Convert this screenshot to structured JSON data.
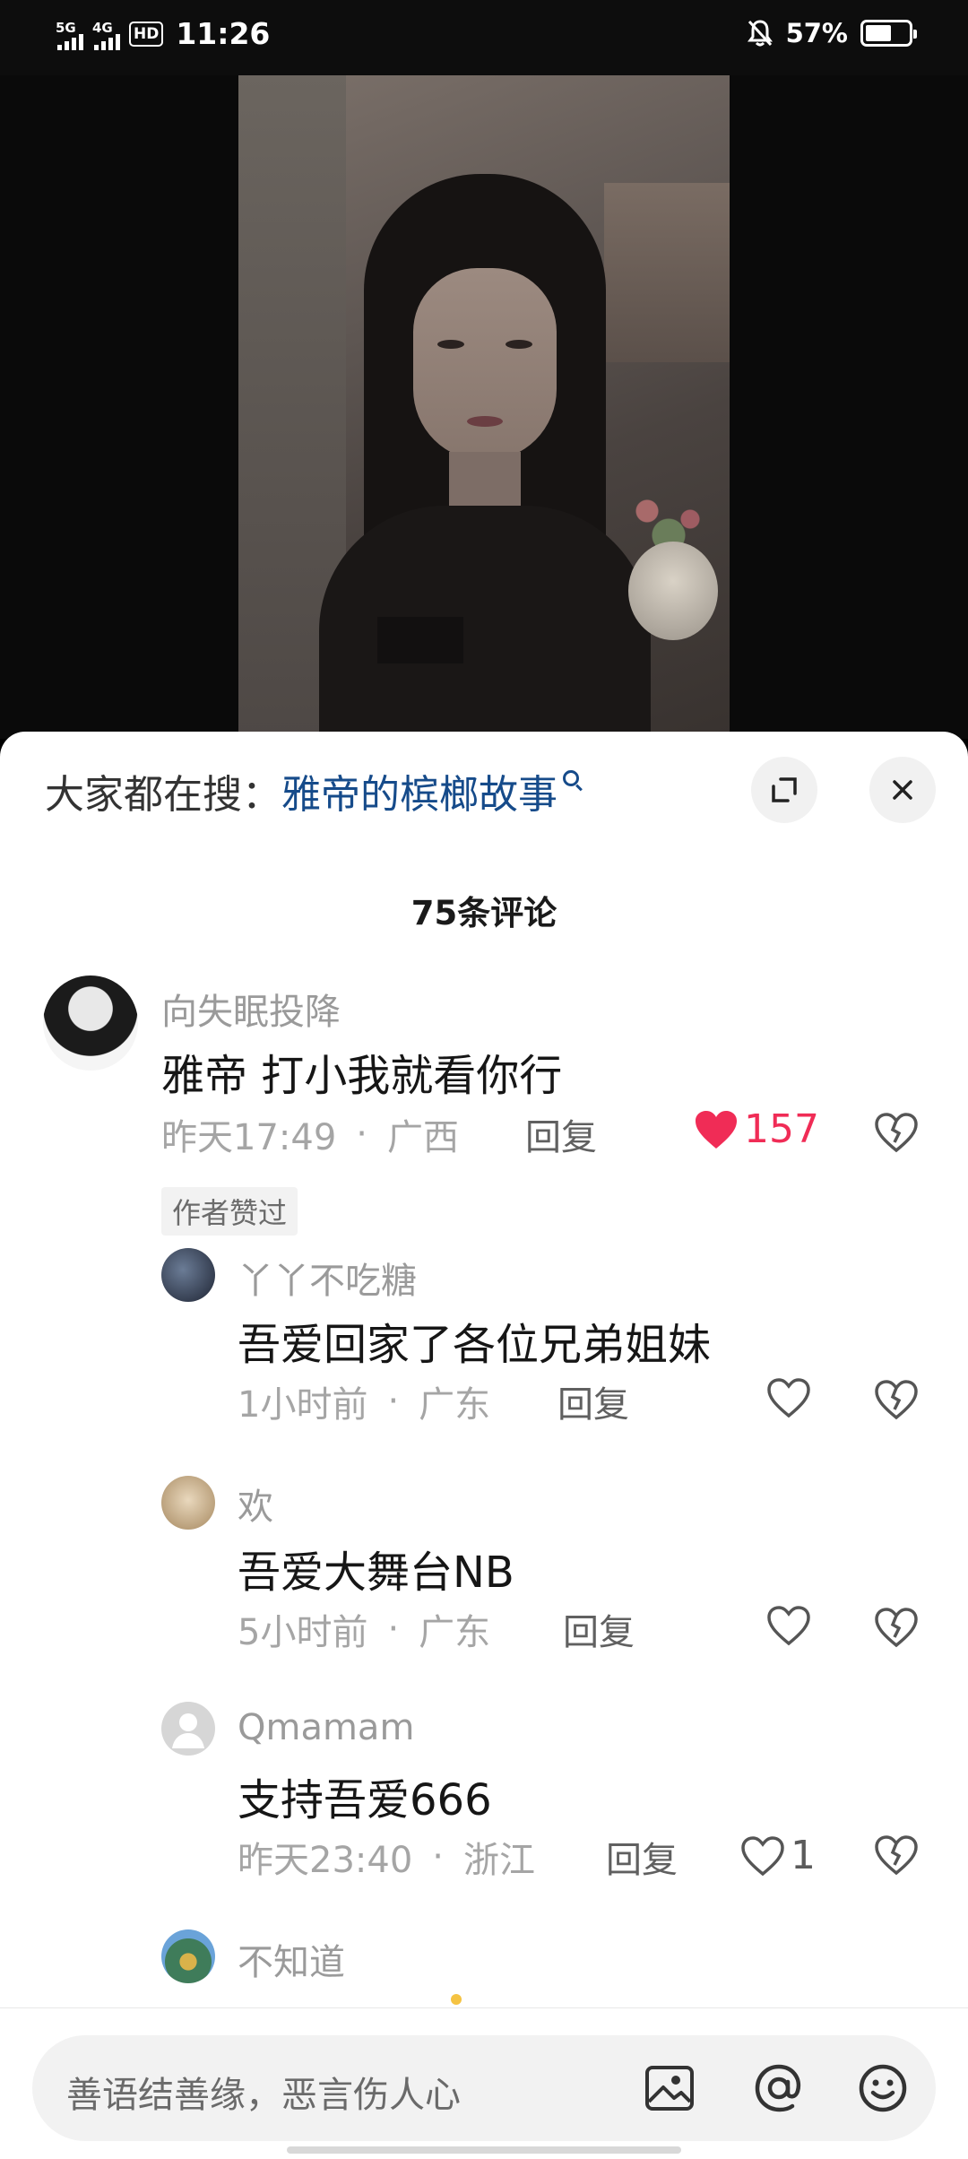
{
  "status_bar": {
    "signal1": "5G",
    "signal2": "4G",
    "hd": "HD",
    "time": "11:26",
    "battery": "57%",
    "battery_level": 0.57
  },
  "panel": {
    "search_prefix": "大家都在搜：",
    "search_term": "雅帝的槟榔故事",
    "comment_count": "75条评论"
  },
  "comments": [
    {
      "user": "向失眠投降",
      "text": "雅帝 打小我就看你行",
      "time": "昨天17:49",
      "location": "广西",
      "reply": "回复",
      "likes": "157",
      "badge": "作者赞过"
    },
    {
      "user": "丫丫不吃糖",
      "text": "吾爱回家了各位兄弟姐妹",
      "time": "1小时前",
      "location": "广东",
      "reply": "回复",
      "likes": ""
    },
    {
      "user": "欢",
      "text": "吾爱大舞台NB",
      "time": "5小时前",
      "location": "广东",
      "reply": "回复",
      "likes": ""
    },
    {
      "user": "Qmamam",
      "text": "支持吾爱666",
      "time": "昨天23:40",
      "location": "浙江",
      "reply": "回复",
      "likes": "1"
    },
    {
      "user": "不知道"
    }
  ],
  "input": {
    "placeholder": "善语结善缘，恶言伤人心"
  },
  "icons": {
    "heart": "heart-icon",
    "broken_heart": "broken-heart-icon",
    "image": "image-icon",
    "at": "at-icon",
    "emoji": "emoji-icon",
    "expand": "expand-icon",
    "close": "close-icon"
  },
  "colors": {
    "like_red": "#f02c56",
    "search_link": "#164b8a"
  }
}
